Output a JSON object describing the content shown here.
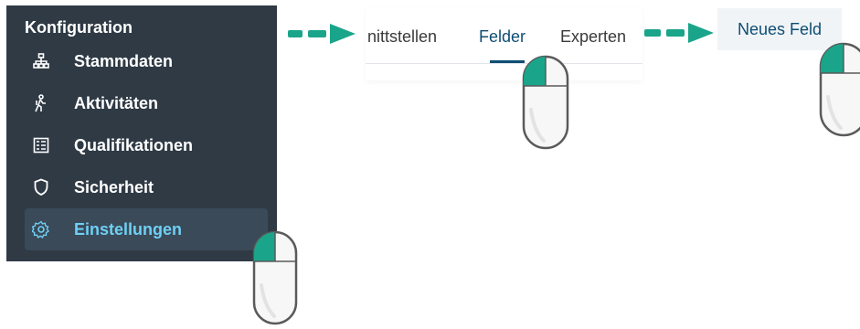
{
  "sidebar": {
    "title": "Konfiguration",
    "items": [
      {
        "label": "Stammdaten",
        "icon": "sitemap-icon"
      },
      {
        "label": "Aktivitäten",
        "icon": "hiking-icon"
      },
      {
        "label": "Qualifikationen",
        "icon": "list-icon"
      },
      {
        "label": "Sicherheit",
        "icon": "shield-icon"
      },
      {
        "label": "Einstellungen",
        "icon": "gear-icon",
        "active": true
      }
    ]
  },
  "tabs": {
    "items": [
      {
        "label": "nittstellen"
      },
      {
        "label": "Felder",
        "active": true
      },
      {
        "label": "Experten"
      }
    ]
  },
  "actions": {
    "new_field_label": "Neues Feld"
  },
  "colors": {
    "sidebar_bg": "#2f3a45",
    "active_text": "#6fcff5",
    "accent": "#0d4e73",
    "arrow": "#1aa58a"
  }
}
